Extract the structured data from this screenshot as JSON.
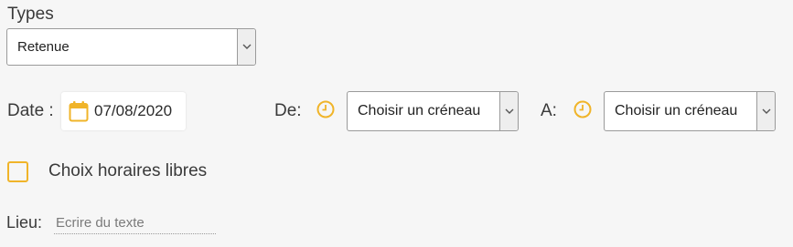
{
  "types": {
    "label": "Types",
    "selected": "Retenue"
  },
  "date": {
    "label": "Date :",
    "value": "07/08/2020",
    "icon": "calendar-icon"
  },
  "from": {
    "label": "De:",
    "icon": "clock-icon",
    "selected": "Choisir un créneau"
  },
  "to": {
    "label": "A:",
    "icon": "clock-icon",
    "selected": "Choisir un créneau"
  },
  "free_hours": {
    "label": "Choix horaires libres",
    "checked": false
  },
  "lieu": {
    "label": "Lieu:",
    "placeholder": "Ecrire du texte",
    "value": ""
  },
  "colors": {
    "accent": "#f0b429",
    "background": "#f6f6f6",
    "border": "#9a9a9a"
  }
}
